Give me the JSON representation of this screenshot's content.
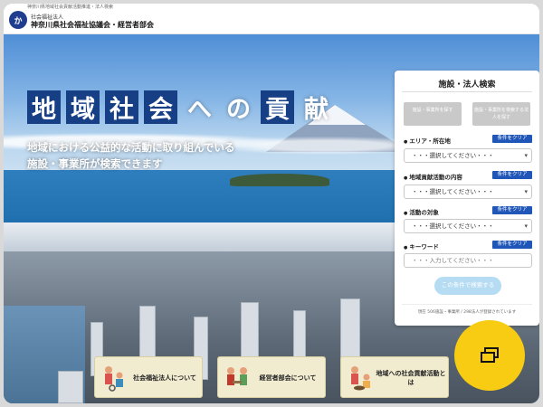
{
  "header": {
    "tagline": "神奈川県地域社会貢献活動推進・法人検索",
    "org_kind": "社会福祉法人",
    "org_name": "神奈川県社会福祉協議会・経営者部会",
    "logo_text": "か"
  },
  "hero": {
    "title_chars": [
      "地",
      "域",
      "社",
      "会",
      "へ",
      "の",
      "貢",
      "献"
    ],
    "lead_line1": "地域における公益的な活動に取り組んでいる",
    "lead_line2": "施設・事業所が検索できます"
  },
  "search_panel": {
    "title": "施設・法人検索",
    "tab1_label": "施設・事業所を探す",
    "tab2_label": "施設・事業所を検索する法人を探す",
    "sections": [
      {
        "label": "エリア・所在地",
        "clear": "条件をクリア",
        "value": "・・・選択してください・・・"
      },
      {
        "label": "地域貢献活動の内容",
        "clear": "条件をクリア",
        "value": "・・・選択してください・・・"
      },
      {
        "label": "活動の対象",
        "clear": "条件をクリア",
        "value": "・・・選択してください・・・"
      }
    ],
    "keyword_label": "キーワード",
    "keyword_clear": "条件をクリア",
    "keyword_placeholder": "・・・入力してください・・・",
    "search_button": "この条件で検索する",
    "registration_note": "現在 506施設・事業所 / 298法人が登録されています"
  },
  "cards": [
    {
      "label": "社会福祉法人について"
    },
    {
      "label": "経営者部会について"
    },
    {
      "label": "地域への社会貢献活動とは"
    }
  ],
  "fab": {
    "icon": "windows-stack-icon"
  },
  "colors": {
    "brand_blue": "#173f86",
    "clear_button": "#1f56b8",
    "fab_yellow": "#f7cc12",
    "card_bg": "#f1ebcf"
  }
}
